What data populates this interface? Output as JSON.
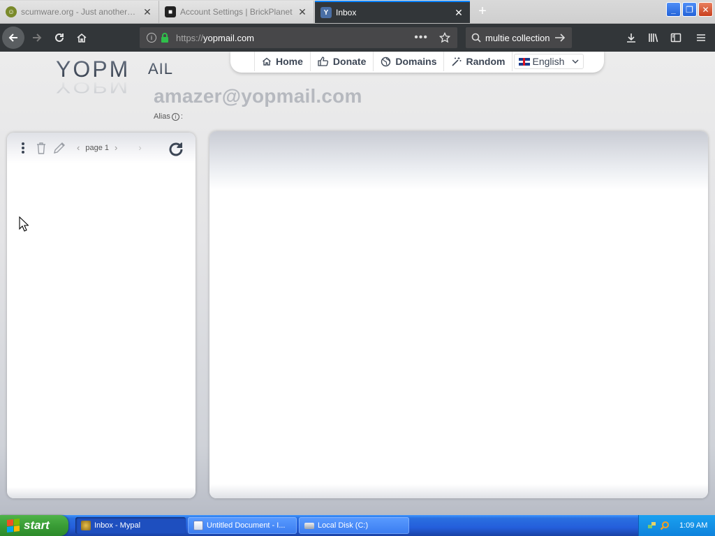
{
  "browser": {
    "tabs": [
      {
        "title": "scumware.org - Just another fr...",
        "active": false
      },
      {
        "title": "Account Settings | BrickPlanet",
        "active": false
      },
      {
        "title": "Inbox",
        "active": true
      }
    ],
    "url_prefix": "https://",
    "url_domain": "yopmail.com",
    "search_text": "multie collection"
  },
  "site": {
    "logo_alt": "YOPMAIL",
    "nav": [
      {
        "label": "Home",
        "icon": "home-icon"
      },
      {
        "label": "Donate",
        "icon": "thumbs-up-icon"
      },
      {
        "label": "Domains",
        "icon": "globe-icon"
      },
      {
        "label": "Random",
        "icon": "magic-wand-icon"
      }
    ],
    "language": "English"
  },
  "inbox": {
    "email": "amazer@yopmail.com",
    "alias_label": "Alias",
    "alias_suffix": ":",
    "page_label": "page 1"
  },
  "taskbar": {
    "start_label": "start",
    "items": [
      {
        "label": "Inbox - Mypal",
        "active": true
      },
      {
        "label": "Untitled Document - I...",
        "active": false
      },
      {
        "label": "Local Disk (C:)",
        "active": false
      }
    ],
    "clock": "1:09 AM"
  },
  "colors": {
    "browser_chrome": "#323639",
    "accent": "#0a84ff",
    "taskbar_blue": "#245edb",
    "start_green": "#3a9d36"
  }
}
